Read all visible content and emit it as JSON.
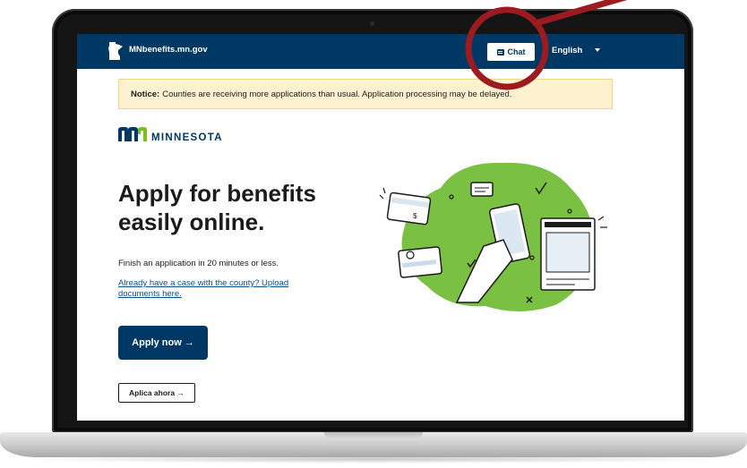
{
  "header": {
    "site_name": "MNbenefits.mn.gov",
    "chat_label": "Chat",
    "language": "English"
  },
  "notice": {
    "label": "Notice:",
    "text": "Counties are receiving more applications than usual. Application processing may be delayed."
  },
  "brand": {
    "wordmark": "MINNESOTA"
  },
  "hero": {
    "title_line1": "Apply for benefits",
    "title_line2": "easily online.",
    "subtitle": "Finish an application in 20 minutes or less.",
    "upload_link": "Already have a case with the county? Upload documents here.",
    "apply_button": "Apply now →",
    "aplica_button": "Aplica ahora →"
  },
  "colors": {
    "brand_navy": "#003865",
    "notice_bg": "#fdf1cf",
    "illustration_green": "#7ac143",
    "annotation_red": "#9b1b20"
  },
  "icons": [
    "minnesota-state-icon",
    "chat-icon",
    "chevron-down-icon",
    "mn-logo-icon"
  ]
}
